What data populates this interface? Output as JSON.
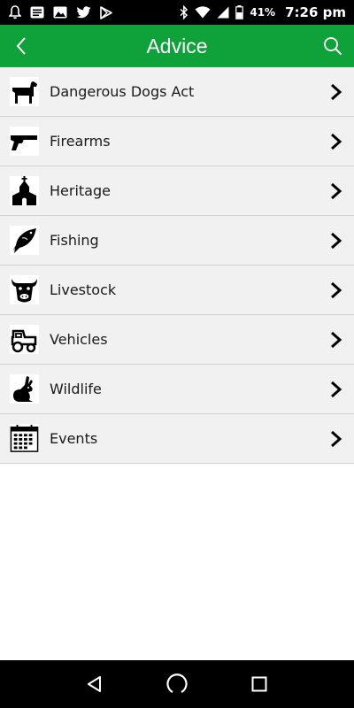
{
  "status_bar": {
    "battery_percent": "41%",
    "time": "7:26 pm",
    "left_icons": [
      "bell-icon",
      "message-icon",
      "image-icon",
      "twitter-icon",
      "play-store-icon"
    ],
    "right_icons": [
      "bluetooth-icon",
      "wifi-icon",
      "cellular-signal-icon",
      "battery-icon"
    ]
  },
  "app_bar": {
    "title": "Advice",
    "back_icon": "back-arrow-icon",
    "search_icon": "search-icon",
    "color": "#10a23a"
  },
  "list": {
    "items": [
      {
        "label": "Dangerous Dogs Act",
        "icon": "dog-icon"
      },
      {
        "label": "Firearms",
        "icon": "gun-icon"
      },
      {
        "label": "Heritage",
        "icon": "church-icon"
      },
      {
        "label": "Fishing",
        "icon": "fish-icon"
      },
      {
        "label": "Livestock",
        "icon": "cow-icon"
      },
      {
        "label": "Vehicles",
        "icon": "tractor-icon"
      },
      {
        "label": "Wildlife",
        "icon": "rabbit-icon"
      },
      {
        "label": "Events",
        "icon": "calendar-icon"
      }
    ]
  },
  "nav_bar": {
    "back": "nav-back-icon",
    "home": "nav-home-icon",
    "recents": "nav-recents-icon"
  }
}
